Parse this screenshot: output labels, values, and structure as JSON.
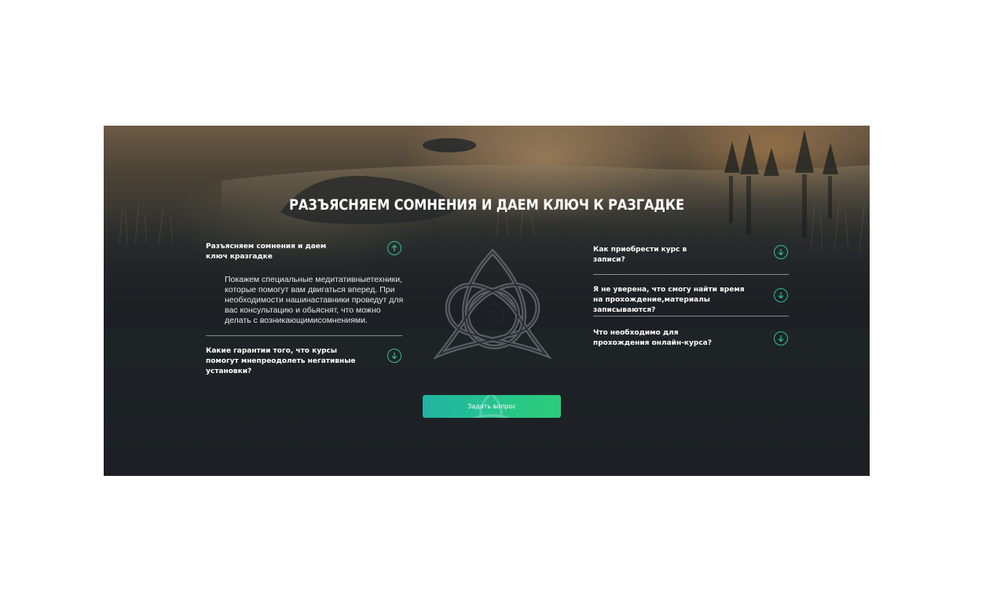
{
  "section": {
    "title": "РАЗЪЯСНЯЕМ СОМНЕНИЯ И ДАЕМ КЛЮЧ К РАЗГАДКЕ"
  },
  "faq_left": [
    {
      "question": "Разъясняем сомнения и даем ключ кразгадке",
      "answer": "Покажем специальные медитативныетехники, которые помогут вам двигаться вперед. При необходимости нашинаставники проведут для вас консультацию и обьяснят, что можно делать с возникающимисомнениями.",
      "expanded": true,
      "icon": "arrow-up-circle-icon"
    },
    {
      "question": "Какие гарантии того, что курсы помогут мнепреодолеть негативные установки?",
      "expanded": false,
      "icon": "arrow-down-circle-icon"
    }
  ],
  "faq_right": [
    {
      "question": "Как приобрести курс в записи?",
      "expanded": false,
      "icon": "arrow-down-circle-icon"
    },
    {
      "question": "Я не уверена, что смогу найти время на прохождение,материалы записываются?",
      "expanded": false,
      "icon": "arrow-down-circle-icon"
    },
    {
      "question": "Что необходимо для прохождения онлайн-курса?",
      "expanded": false,
      "icon": "arrow-down-circle-icon"
    }
  ],
  "cta": {
    "label": "Задать вопрос"
  },
  "decor": {
    "emblem": "celtic-triquetra-icon"
  },
  "colors": {
    "accent": "#2fbf97",
    "button_gradient_start": "#21b3a2",
    "button_gradient_end": "#2ccc78",
    "panel_bg": "#1c2024",
    "text": "#ffffff"
  }
}
